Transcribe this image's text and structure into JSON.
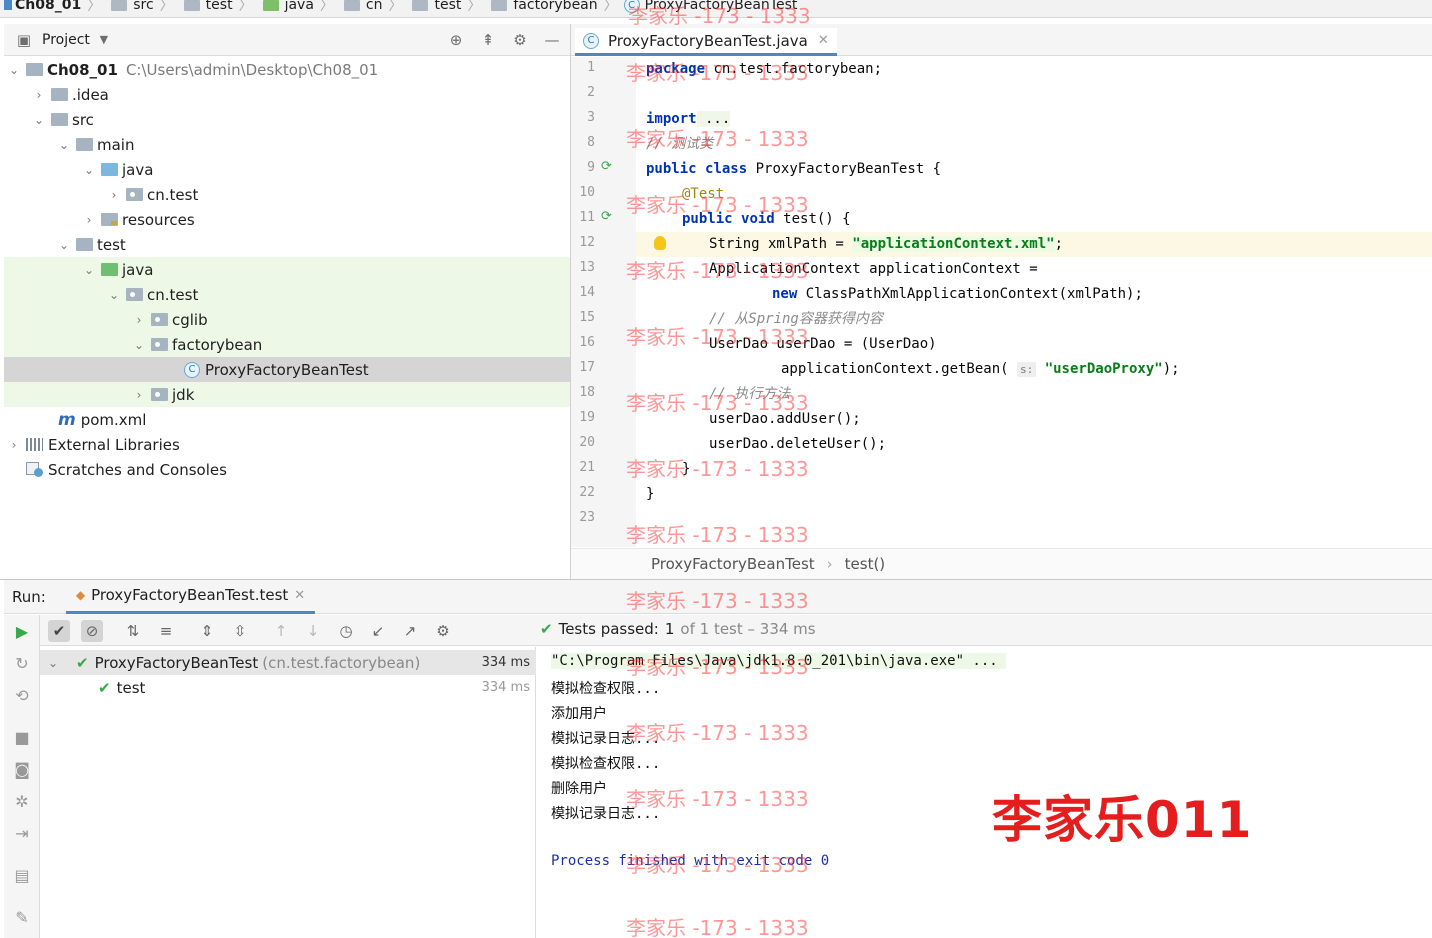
{
  "navbar": {
    "items": [
      "Ch08_01",
      "src",
      "test",
      "java",
      "cn",
      "test",
      "factorybean",
      "ProxyFactoryBeanTest"
    ]
  },
  "project_panel": {
    "title": "Project",
    "tree": [
      {
        "label": "Ch08_01",
        "path": "C:\\Users\\admin\\Desktop\\Ch08_01"
      },
      {
        "label": ".idea"
      },
      {
        "label": "src"
      },
      {
        "label": "main"
      },
      {
        "label": "java"
      },
      {
        "label": "cn.test"
      },
      {
        "label": "resources"
      },
      {
        "label": "test"
      },
      {
        "label": "java"
      },
      {
        "label": "cn.test"
      },
      {
        "label": "cglib"
      },
      {
        "label": "factorybean"
      },
      {
        "label": "ProxyFactoryBeanTest"
      },
      {
        "label": "jdk"
      },
      {
        "label": "pom.xml"
      },
      {
        "label": "External Libraries"
      },
      {
        "label": "Scratches and Consoles"
      }
    ]
  },
  "editor": {
    "tab_label": "ProxyFactoryBeanTest.java",
    "line_numbers": [
      "1",
      "2",
      "3",
      "8",
      "9",
      "10",
      "11",
      "12",
      "13",
      "14",
      "15",
      "16",
      "17",
      "18",
      "19",
      "20",
      "21",
      "22",
      "23"
    ],
    "code": {
      "l1_kw": "package",
      "l1_rest": " cn.test.factorybean;",
      "l3_kw": "import",
      "l3_rest": " ...",
      "l8_cmt": "// 测试类",
      "l9_kw1": "public",
      "l9_kw2": "class",
      "l9_rest": " ProxyFactoryBeanTest {",
      "l10_ann": "@Test",
      "l11_kw1": "public",
      "l11_kw2": "void",
      "l11_rest": " test() {",
      "l12_pre": "String xmlPath = ",
      "l12_str": "\"applicationContext.xml\"",
      "l12_post": ";",
      "l13": "ApplicationContext applicationContext =",
      "l14_kw": "new",
      "l14_rest": " ClassPathXmlApplicationContext(xmlPath);",
      "l15_cmt": "// 从Spring容器获得内容",
      "l16": "UserDao userDao = (UserDao)",
      "l17_pre": "applicationContext.getBean( ",
      "l17_hint": "s:",
      "l17_str": "\"userDaoProxy\"",
      "l17_post": ");",
      "l18_cmt": "// 执行方法",
      "l19": "userDao.addUser();",
      "l20": "userDao.deleteUser();",
      "l21": "}",
      "l22": "}"
    },
    "breadcrumb": [
      "ProxyFactoryBeanTest",
      "test()"
    ]
  },
  "run_panel": {
    "label": "Run:",
    "tab_label": "ProxyFactoryBeanTest.test",
    "status_prefix": "Tests passed:",
    "status_count": "1",
    "status_suffix": "of 1 test – 334 ms",
    "tests": [
      {
        "name": "ProxyFactoryBeanTest",
        "package": "(cn.test.factorybean)",
        "time": "334 ms"
      },
      {
        "name": "test",
        "time": "334 ms"
      }
    ],
    "console": [
      "\"C:\\Program Files\\Java\\jdk1.8.0_201\\bin\\java.exe\" ...",
      "模拟检查权限...",
      "添加用户",
      "模拟记录日志...",
      "模拟检查权限...",
      "删除用户",
      "模拟记录日志...",
      "",
      "Process finished with exit code 0"
    ]
  },
  "overlay_name": "李家乐011",
  "watermark_text": "李家乐 -173 - 1333",
  "colors": {
    "accent": "#4a88c7",
    "keyword": "#0033b3",
    "string": "#067d17",
    "pass": "#3aa84a",
    "overlay": "#e41e1e"
  }
}
